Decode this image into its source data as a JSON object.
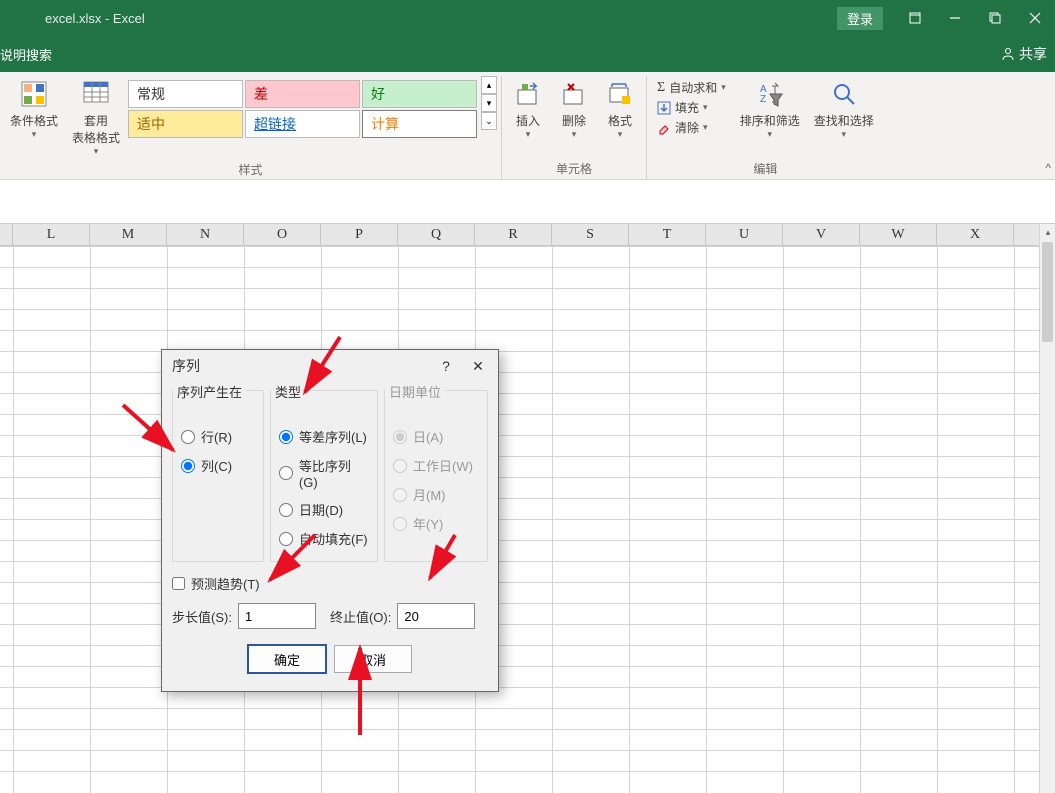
{
  "titlebar": {
    "filename": "excel.xlsx",
    "sep": " - ",
    "appname": "Excel",
    "login": "登录"
  },
  "menubar": {
    "search": "说明搜索",
    "share": "共享"
  },
  "ribbon": {
    "cond_format": "条件格式",
    "table_format": "套用\n表格格式",
    "styles": {
      "normal": "常规",
      "bad": "差",
      "good": "好",
      "neutral": "适中",
      "link": "超链接",
      "calc": "计算"
    },
    "styles_label": "样式",
    "insert": "插入",
    "delete": "删除",
    "format": "格式",
    "cells_label": "单元格",
    "autosum": "自动求和",
    "fill": "填充",
    "clear": "清除",
    "sortfilter": "排序和筛选",
    "findselect": "查找和选择",
    "edit_label": "编辑"
  },
  "columns": [
    "L",
    "M",
    "N",
    "O",
    "P",
    "Q",
    "R",
    "S",
    "T",
    "U",
    "V",
    "W",
    "X"
  ],
  "dialog": {
    "title": "序列",
    "group_in": "序列产生在",
    "row": "行(R)",
    "col": "列(C)",
    "group_type": "类型",
    "arith": "等差序列(L)",
    "geom": "等比序列(G)",
    "date": "日期(D)",
    "autofill": "自动填充(F)",
    "group_dateunit": "日期单位",
    "day": "日(A)",
    "weekday": "工作日(W)",
    "month": "月(M)",
    "year": "年(Y)",
    "trend": "预测趋势(T)",
    "step_label": "步长值(S):",
    "step_val": "1",
    "stop_label": "终止值(O):",
    "stop_val": "20",
    "ok": "确定",
    "cancel": "取消"
  }
}
